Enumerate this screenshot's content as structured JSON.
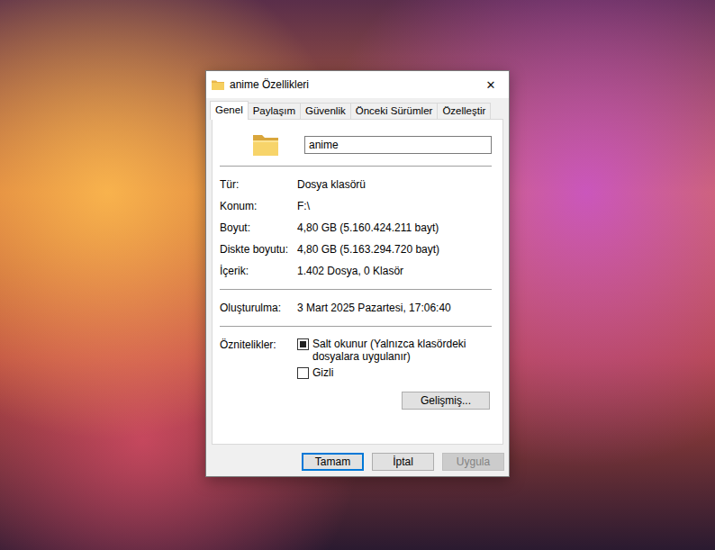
{
  "window": {
    "title": "anime Özellikleri",
    "close": "✕"
  },
  "tabs": [
    {
      "label": "Genel",
      "selected": true
    },
    {
      "label": "Paylaşım",
      "selected": false
    },
    {
      "label": "Güvenlik",
      "selected": false
    },
    {
      "label": "Önceki Sürümler",
      "selected": false
    },
    {
      "label": "Özelleştir",
      "selected": false
    }
  ],
  "name_field": {
    "value": "anime"
  },
  "sections": [
    [
      {
        "label": "Tür:",
        "value": "Dosya klasörü"
      },
      {
        "label": "Konum:",
        "value": "F:\\"
      },
      {
        "label": "Boyut:",
        "value": "4,80 GB (5.160.424.211 bayt)"
      },
      {
        "label": "Diskte boyutu:",
        "value": "4,80 GB (5.163.294.720 bayt)"
      },
      {
        "label": "İçerik:",
        "value": "1.402 Dosya, 0 Klasör"
      }
    ],
    [
      {
        "label": "Oluşturulma:",
        "value": "3 Mart 2025 Pazartesi, 17:06:40"
      }
    ]
  ],
  "attributes": {
    "label": "Öznitelikler:",
    "checkboxes": [
      {
        "label": "Salt okunur (Yalnızca klasördeki dosyalara uygulanır)",
        "checked": false,
        "mixed": true
      },
      {
        "label": "Gizli",
        "checked": false,
        "mixed": false
      }
    ],
    "advanced_button": "Gelişmiş..."
  },
  "buttons": [
    {
      "label": "Tamam",
      "default": true,
      "disabled": false
    },
    {
      "label": "İptal",
      "default": false,
      "disabled": false
    },
    {
      "label": "Uygula",
      "default": false,
      "disabled": true
    }
  ]
}
